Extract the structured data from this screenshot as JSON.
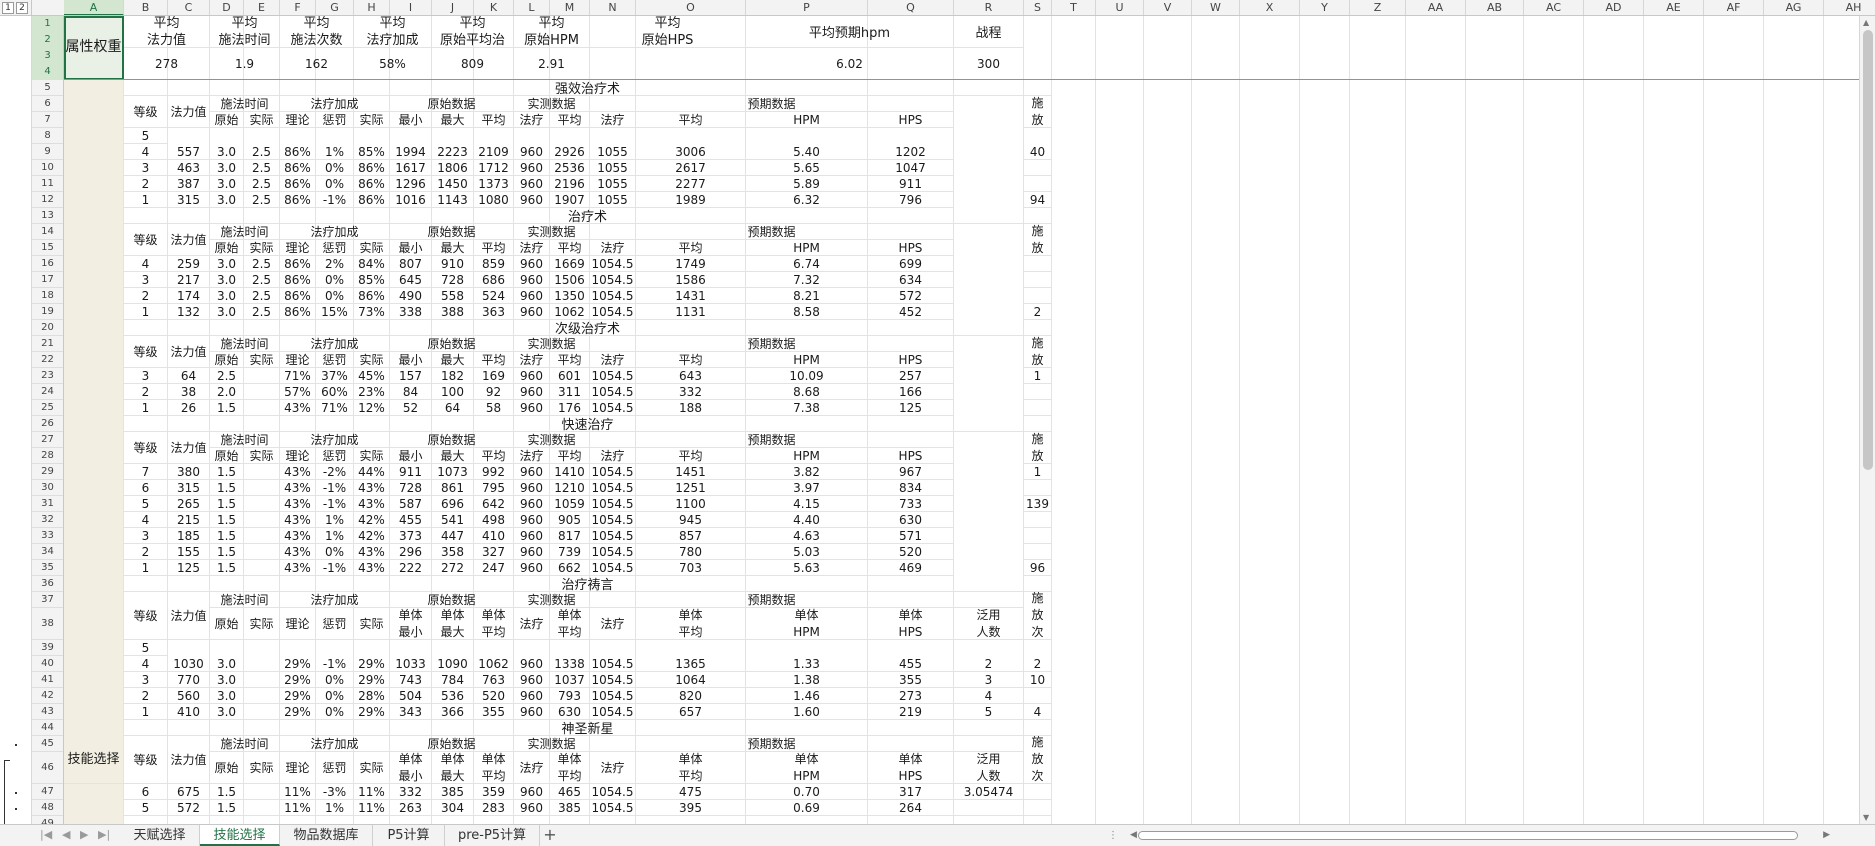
{
  "outline": {
    "levels": [
      "1",
      "2"
    ]
  },
  "columns": [
    "A",
    "B",
    "C",
    "D",
    "E",
    "F",
    "G",
    "H",
    "I",
    "J",
    "K",
    "L",
    "M",
    "N",
    "O",
    "P",
    "Q",
    "R",
    "S",
    "T",
    "U",
    "V",
    "W",
    "X",
    "Y",
    "Z",
    "AA",
    "AB",
    "AC",
    "AD",
    "AE",
    "AF",
    "AG",
    "AH"
  ],
  "selected_column": "A",
  "rows": [
    "1",
    "2",
    "3",
    "4",
    "5",
    "6",
    "7",
    "8",
    "9",
    "10",
    "11",
    "12",
    "13",
    "14",
    "15",
    "16",
    "17",
    "18",
    "19",
    "20",
    "21",
    "22",
    "23",
    "24",
    "25",
    "26",
    "27",
    "28",
    "29",
    "30",
    "31",
    "32",
    "33",
    "34",
    "35",
    "36",
    "37",
    "38",
    "39",
    "40",
    "41",
    "42",
    "43",
    "44",
    "45",
    "46",
    "47",
    "48",
    "49"
  ],
  "selected_rows": [
    "1",
    "2",
    "3",
    "4"
  ],
  "cells": {
    "A1": "属性权重",
    "A_skill": "技能选择",
    "B1": "平均\n法力值",
    "D1": "平均\n施法时间",
    "F1": "平均\n施法次数",
    "H1": "平均\n法疗加成",
    "J1": "平均\n原始平均治",
    "L1": "平均\n原始HPM",
    "N1": "平均\n原始HPS",
    "P1": "平均预期hpm",
    "R1": "战程",
    "B3": "278",
    "D3": "1.9",
    "F3": "162",
    "H3": "58%",
    "J3": "809",
    "L3": "2.91",
    "P3": "6.02",
    "R3": "300",
    "r5": "强效治疗术",
    "r13": "治疗术",
    "r20": "次级治疗术",
    "r26": "快速治疗",
    "r36": "治疗祷言",
    "r44": "神圣新星",
    "h_level": "等级",
    "h_mana": "法力值",
    "h_cast": "施法时间",
    "h_bonus": "法疗加成",
    "h_raw": "原始数据",
    "h_meas": "实测数据",
    "h_pred": "预期数据",
    "h_use": "施\n放",
    "h_use2": "施\n放\n次",
    "h_orig": "原始",
    "h_actual": "实际",
    "h_theory": "理论",
    "h_penalty": "惩罚",
    "h_min": "最小",
    "h_max": "最大",
    "h_avg": "平均",
    "h_heal": "法疗",
    "h_hpm": "HPM",
    "h_hps": "HPS",
    "h_smin": "单体\n最小",
    "h_smax": "单体\n最大",
    "h_savg": "单体\n平均",
    "h_shpm": "单体\nHPM",
    "h_shps": "单体\nHPS",
    "h_targets": "泛用\n人数",
    "r8": "5",
    "r39": "5"
  },
  "greater_heal": [
    [
      "4",
      "557",
      "3.0",
      "2.5",
      "86%",
      "1%",
      "85%",
      "1994",
      "2223",
      "2109",
      "960",
      "2926",
      "1055",
      "3006",
      "5.40",
      "1202",
      "40"
    ],
    [
      "3",
      "463",
      "3.0",
      "2.5",
      "86%",
      "0%",
      "86%",
      "1617",
      "1806",
      "1712",
      "960",
      "2536",
      "1055",
      "2617",
      "5.65",
      "1047",
      ""
    ],
    [
      "2",
      "387",
      "3.0",
      "2.5",
      "86%",
      "0%",
      "86%",
      "1296",
      "1450",
      "1373",
      "960",
      "2196",
      "1055",
      "2277",
      "5.89",
      "911",
      ""
    ],
    [
      "1",
      "315",
      "3.0",
      "2.5",
      "86%",
      "-1%",
      "86%",
      "1016",
      "1143",
      "1080",
      "960",
      "1907",
      "1055",
      "1989",
      "6.32",
      "796",
      "94"
    ]
  ],
  "heal": [
    [
      "4",
      "259",
      "3.0",
      "2.5",
      "86%",
      "2%",
      "84%",
      "807",
      "910",
      "859",
      "960",
      "1669",
      "1054.5",
      "1749",
      "6.74",
      "699",
      ""
    ],
    [
      "3",
      "217",
      "3.0",
      "2.5",
      "86%",
      "0%",
      "85%",
      "645",
      "728",
      "686",
      "960",
      "1506",
      "1054.5",
      "1586",
      "7.32",
      "634",
      ""
    ],
    [
      "2",
      "174",
      "3.0",
      "2.5",
      "86%",
      "0%",
      "86%",
      "490",
      "558",
      "524",
      "960",
      "1350",
      "1054.5",
      "1431",
      "8.21",
      "572",
      ""
    ],
    [
      "1",
      "132",
      "3.0",
      "2.5",
      "86%",
      "15%",
      "73%",
      "338",
      "388",
      "363",
      "960",
      "1062",
      "1054.5",
      "1131",
      "8.58",
      "452",
      "2"
    ]
  ],
  "lesser_heal": [
    [
      "3",
      "64",
      "2.5",
      "",
      "71%",
      "37%",
      "45%",
      "157",
      "182",
      "169",
      "960",
      "601",
      "1054.5",
      "643",
      "10.09",
      "257",
      "1"
    ],
    [
      "2",
      "38",
      "2.0",
      "",
      "57%",
      "60%",
      "23%",
      "84",
      "100",
      "92",
      "960",
      "311",
      "1054.5",
      "332",
      "8.68",
      "166",
      ""
    ],
    [
      "1",
      "26",
      "1.5",
      "",
      "43%",
      "71%",
      "12%",
      "52",
      "64",
      "58",
      "960",
      "176",
      "1054.5",
      "188",
      "7.38",
      "125",
      ""
    ]
  ],
  "flash_heal": [
    [
      "7",
      "380",
      "1.5",
      "",
      "43%",
      "-2%",
      "44%",
      "911",
      "1073",
      "992",
      "960",
      "1410",
      "1054.5",
      "1451",
      "3.82",
      "967",
      "1"
    ],
    [
      "6",
      "315",
      "1.5",
      "",
      "43%",
      "-1%",
      "43%",
      "728",
      "861",
      "795",
      "960",
      "1210",
      "1054.5",
      "1251",
      "3.97",
      "834",
      ""
    ],
    [
      "5",
      "265",
      "1.5",
      "",
      "43%",
      "-1%",
      "43%",
      "587",
      "696",
      "642",
      "960",
      "1059",
      "1054.5",
      "1100",
      "4.15",
      "733",
      "139"
    ],
    [
      "4",
      "215",
      "1.5",
      "",
      "43%",
      "1%",
      "42%",
      "455",
      "541",
      "498",
      "960",
      "905",
      "1054.5",
      "945",
      "4.40",
      "630",
      ""
    ],
    [
      "3",
      "185",
      "1.5",
      "",
      "43%",
      "1%",
      "42%",
      "373",
      "447",
      "410",
      "960",
      "817",
      "1054.5",
      "857",
      "4.63",
      "571",
      ""
    ],
    [
      "2",
      "155",
      "1.5",
      "",
      "43%",
      "0%",
      "43%",
      "296",
      "358",
      "327",
      "960",
      "739",
      "1054.5",
      "780",
      "5.03",
      "520",
      ""
    ],
    [
      "1",
      "125",
      "1.5",
      "",
      "43%",
      "-1%",
      "43%",
      "222",
      "272",
      "247",
      "960",
      "662",
      "1054.5",
      "703",
      "5.63",
      "469",
      "96"
    ]
  ],
  "prayer_of_healing": [
    [
      "4",
      "1030",
      "3.0",
      "",
      "29%",
      "-1%",
      "29%",
      "1033",
      "1090",
      "1062",
      "960",
      "1338",
      "1054.5",
      "1365",
      "1.33",
      "455",
      "2",
      "2"
    ],
    [
      "3",
      "770",
      "3.0",
      "",
      "29%",
      "0%",
      "29%",
      "743",
      "784",
      "763",
      "960",
      "1037",
      "1054.5",
      "1064",
      "1.38",
      "355",
      "3",
      "10"
    ],
    [
      "2",
      "560",
      "3.0",
      "",
      "29%",
      "0%",
      "28%",
      "504",
      "536",
      "520",
      "960",
      "793",
      "1054.5",
      "820",
      "1.46",
      "273",
      "4",
      ""
    ],
    [
      "1",
      "410",
      "3.0",
      "",
      "29%",
      "0%",
      "29%",
      "343",
      "366",
      "355",
      "960",
      "630",
      "1054.5",
      "657",
      "1.60",
      "219",
      "5",
      "4"
    ]
  ],
  "holy_nova": [
    [
      "6",
      "675",
      "1.5",
      "",
      "11%",
      "-3%",
      "11%",
      "332",
      "385",
      "359",
      "960",
      "465",
      "1054.5",
      "475",
      "0.70",
      "317",
      "3.05474",
      ""
    ],
    [
      "5",
      "572",
      "1.5",
      "",
      "11%",
      "1%",
      "11%",
      "263",
      "304",
      "283",
      "960",
      "385",
      "1054.5",
      "395",
      "0.69",
      "264",
      "",
      ""
    ]
  ],
  "sheets": [
    "天赋选择",
    "技能选择",
    "物品数据库",
    "P5计算",
    "pre-P5计算"
  ],
  "active_sheet": "技能选择",
  "add_sheet": "+",
  "colors": {
    "accent": "#217346",
    "tan": "#f2eee2",
    "header_bg": "#f3f3f3"
  }
}
